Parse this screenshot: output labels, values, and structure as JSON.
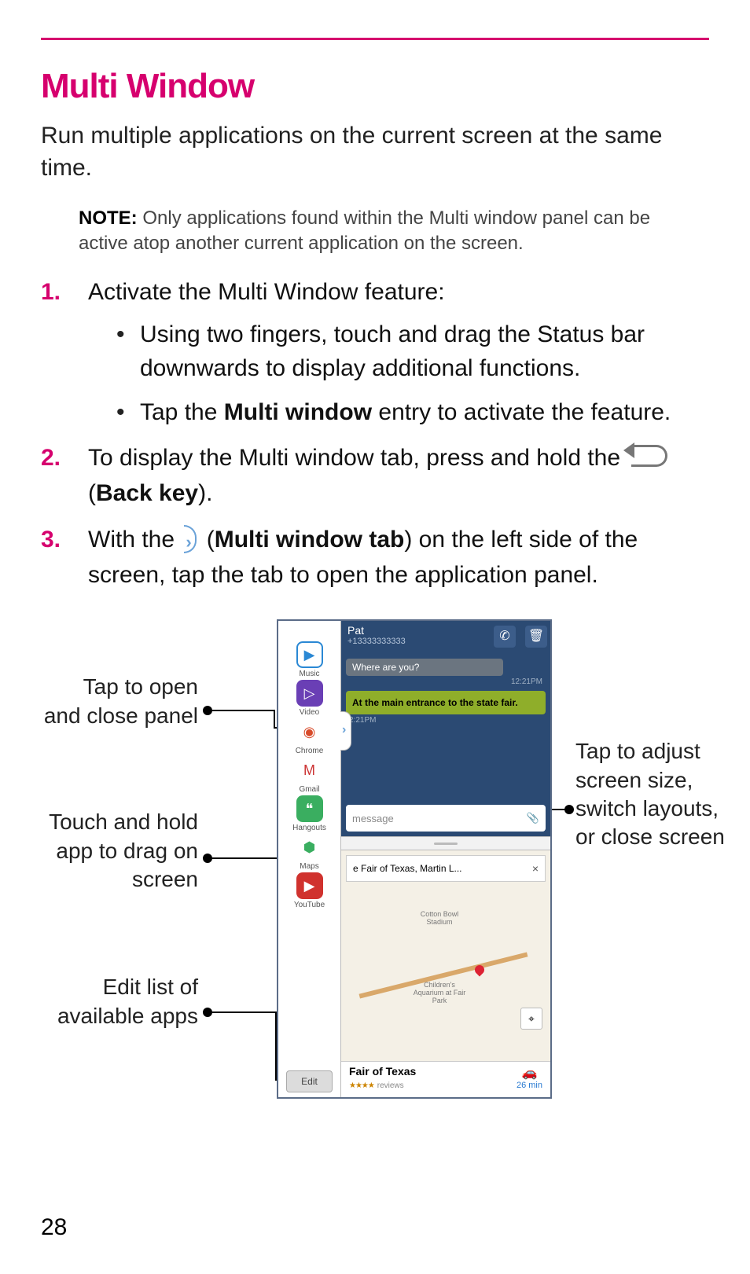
{
  "heading": "Multi Window",
  "intro": "Run multiple applications on the current screen at the same time.",
  "note_label": "NOTE:",
  "note_text": "Only applications found within the Multi window panel can be active atop another current application on the screen.",
  "steps": {
    "s1": {
      "num": "1.",
      "text": "Activate the Multi Window feature:"
    },
    "s1a": "Using two fingers, touch and drag the Status bar downwards to display additional functions.",
    "s1b_pre": "Tap the ",
    "s1b_bold": "Multi window",
    "s1b_post": " entry to activate the feature.",
    "s2": {
      "num": "2.",
      "pre": "To display the Multi window tab, press and hold the ",
      "post_open": " (",
      "post_bold": "Back key",
      "post_close": ")."
    },
    "s3": {
      "num": "3.",
      "pre": "With the ",
      "mid_open": " (",
      "mid_bold": "Multi window tab",
      "mid_close": ") on the left side of the screen, tap the tab to open the application panel."
    }
  },
  "callouts": {
    "c1": "Tap to open and close panel",
    "c2": "Touch and hold app to drag on screen",
    "c3": "Edit list of available apps",
    "c4": "Tap to adjust screen size, switch layouts, or close screen"
  },
  "screenshot": {
    "contact_name": "Pat",
    "contact_number": "+13333333333",
    "msg_stub": "Where are you?",
    "time1": "12:21PM",
    "msg_green": "At the main entrance to the state fair.",
    "time2": "2:21PM",
    "input_placeholder": "message",
    "map_search": "e Fair of Texas, Martin L...",
    "map_label1": "Cotton Bowl Stadium",
    "map_label2": "Children's Aquarium at Fair Park",
    "place_title": "Fair of Texas",
    "place_reviews": "reviews",
    "drive_eta": "26 min",
    "apps": [
      {
        "label": "Music",
        "bg": "#ffffff",
        "brd": "#2a88d4",
        "glyph": "▶",
        "fg": "#2a88d4"
      },
      {
        "label": "Video",
        "bg": "#6a3fb5",
        "glyph": "▷"
      },
      {
        "label": "Chrome",
        "bg": "#ffffff",
        "glyph": "◉",
        "fg": "#d84b2a"
      },
      {
        "label": "Gmail",
        "bg": "#ffffff",
        "glyph": "M",
        "fg": "#c33"
      },
      {
        "label": "Hangouts",
        "bg": "#3aae60",
        "glyph": "❝"
      },
      {
        "label": "Maps",
        "bg": "#ffffff",
        "glyph": "⬢",
        "fg": "#3aae60"
      },
      {
        "label": "YouTube",
        "bg": "#d0322e",
        "glyph": "▶"
      }
    ],
    "edit_label": "Edit"
  },
  "page_number": "28"
}
